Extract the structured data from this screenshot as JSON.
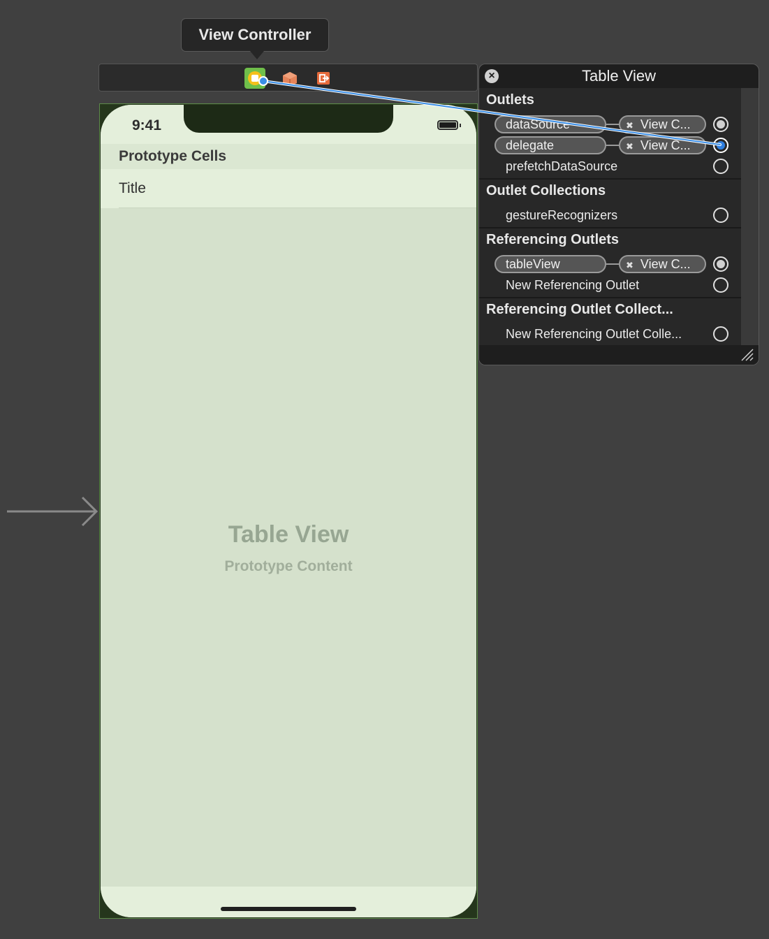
{
  "tooltip": {
    "label": "View Controller"
  },
  "dock": {
    "icons": [
      "view-controller-icon",
      "first-responder-icon",
      "exit-icon"
    ],
    "colors": {
      "view_controller": "#f4c01b",
      "first_responder": "#e5845a",
      "exit": "#e66b3c"
    }
  },
  "device": {
    "status_time": "9:41",
    "section_header": "Prototype Cells",
    "cell_title": "Title",
    "placeholder_title": "Table View",
    "placeholder_subtitle": "Prototype Content"
  },
  "panel": {
    "title": "Table View",
    "groups": [
      {
        "header": "Outlets",
        "rows": [
          {
            "label": "dataSource",
            "target": "View C...",
            "state": "connected"
          },
          {
            "label": "delegate",
            "target": "View C...",
            "state": "dragging"
          },
          {
            "label": "prefetchDataSource",
            "target": "",
            "state": "empty"
          }
        ]
      },
      {
        "header": "Outlet Collections",
        "rows": [
          {
            "label": "gestureRecognizers",
            "target": "",
            "state": "empty"
          }
        ]
      },
      {
        "header": "Referencing Outlets",
        "rows": [
          {
            "label": "tableView",
            "target": "View C...",
            "state": "connected"
          },
          {
            "label": "New Referencing Outlet",
            "target": "",
            "state": "empty"
          }
        ]
      },
      {
        "header": "Referencing Outlet Collect...",
        "rows": [
          {
            "label": "New Referencing Outlet Colle...",
            "target": "",
            "state": "empty"
          }
        ]
      }
    ]
  },
  "colors": {
    "canvas": "#404040",
    "screen": "#d5e1cc",
    "connection_wire": "#3a8ee6"
  }
}
